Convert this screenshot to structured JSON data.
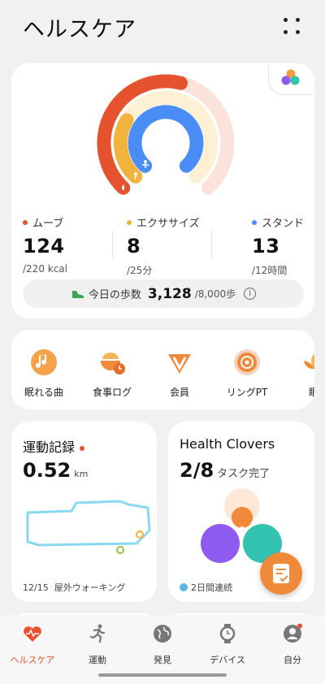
{
  "header": {
    "title": "ヘルスケア",
    "more_icon": "dots-grid-icon"
  },
  "activity": {
    "rings": [
      {
        "name": "move",
        "color": "#e4532d",
        "fraction": 0.56
      },
      {
        "name": "exercise",
        "color": "#f2b33d",
        "fraction": 0.32
      },
      {
        "name": "stand",
        "color": "#4a8df6",
        "fraction": 1.0
      }
    ],
    "stats": [
      {
        "label": "ムーブ",
        "value": "124",
        "goal": "/220 kcal",
        "color": "#e4532d"
      },
      {
        "label": "エクササイズ",
        "value": "8",
        "goal": "/25分",
        "color": "#f2b33d"
      },
      {
        "label": "スタンド",
        "value": "13",
        "goal": "/12時間",
        "color": "#4a8df6"
      }
    ],
    "steps": {
      "label": "今日の歩数",
      "value": "3,128",
      "goal": "/8,000歩",
      "info_icon": "info-icon"
    }
  },
  "shortcuts": [
    {
      "label": "眠れる曲",
      "icon": "music-moon-icon"
    },
    {
      "label": "食事ログ",
      "icon": "meal-log-icon"
    },
    {
      "label": "会員",
      "icon": "vip-badge-icon"
    },
    {
      "label": "リングPT",
      "icon": "ring-signal-icon"
    },
    {
      "label": "眠",
      "icon": "lotus-icon"
    }
  ],
  "exercise": {
    "title": "運動記録",
    "value": "0.52",
    "unit": "km",
    "date": "12/15",
    "type": "屋外ウォーキング"
  },
  "clovers": {
    "title": "Health Clovers",
    "value": "2/8",
    "suffix": "タスク完了",
    "streak": "2日間連続"
  },
  "tabs": [
    {
      "label": "ヘルスケア",
      "icon": "heart-pulse-icon",
      "active": true
    },
    {
      "label": "運動",
      "icon": "running-icon",
      "active": false
    },
    {
      "label": "発見",
      "icon": "globe-icon",
      "active": false
    },
    {
      "label": "デバイス",
      "icon": "watch-icon",
      "active": false
    },
    {
      "label": "自分",
      "icon": "profile-icon",
      "active": false
    }
  ],
  "colors": {
    "accent": "#e9512e",
    "orange": "#ef8a3b",
    "purple": "#8e5bf0",
    "teal": "#35c3b1"
  }
}
